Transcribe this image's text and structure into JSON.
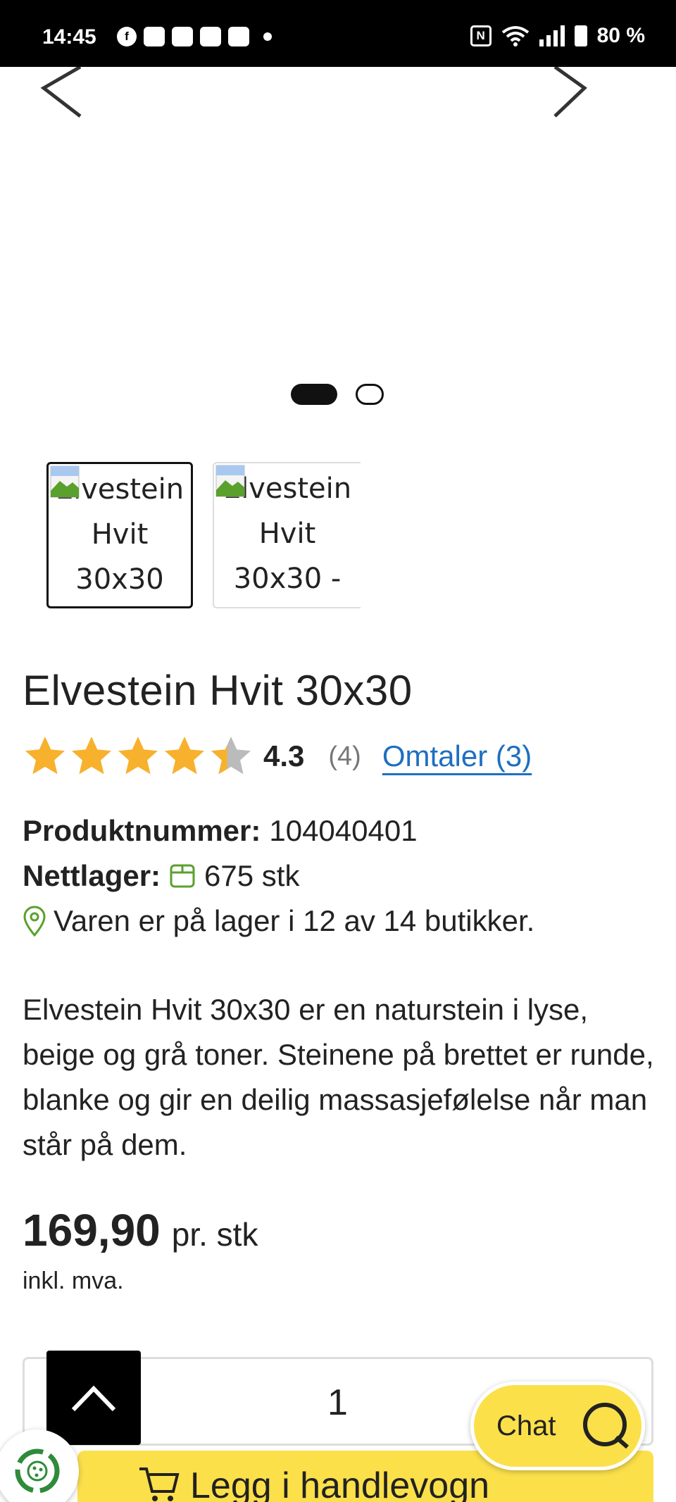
{
  "status_bar": {
    "time": "14:45",
    "battery": "80 %",
    "apps": [
      "f",
      "☐",
      "☐",
      "☐",
      "☐"
    ]
  },
  "carousel": {
    "slide_count": 2,
    "active_slide": 1
  },
  "thumbnails": [
    {
      "alt": "Elvestein Hvit 30x30",
      "active": true
    },
    {
      "alt": "Elvestein Hvit 30x30 -",
      "active": false
    }
  ],
  "product": {
    "title": "Elvestein Hvit 30x30",
    "rating": {
      "value": "4.3",
      "stars_filled": 4.3,
      "stars_max": 5,
      "count": "(4)",
      "reviews_link": "Omtaler (3)"
    },
    "product_number_label": "Produktnummer:",
    "product_number": "104040401",
    "stock_label": "Nettlager:",
    "stock_value": "675 stk",
    "store_availability": "Varen er på lager i 12 av 14 butikker.",
    "description": "Elvestein Hvit 30x30 er en naturstein i lyse, beige og grå toner. Steinene på brettet er runde, blanke og gir en deilig massasjefølelse når man står på dem.",
    "price": "169,90",
    "price_unit": "pr. stk",
    "vat_note": "inkl. mva."
  },
  "purchase": {
    "quantity": "1",
    "add_to_cart_label": "Legg i handlevogn"
  },
  "chat": {
    "label": "Chat"
  },
  "colors": {
    "accent_yellow": "#fbe04a",
    "link_blue": "#1e6fbf",
    "star_orange": "#f8b12c",
    "success_green": "#5aa02c"
  }
}
